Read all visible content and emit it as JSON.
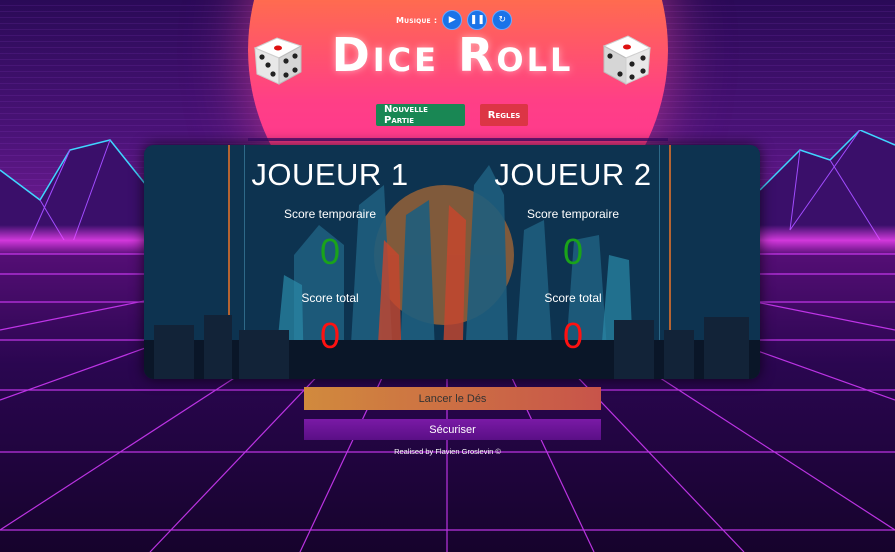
{
  "header": {
    "music_label": "Musique :",
    "music_buttons": [
      {
        "icon": "play-icon"
      },
      {
        "icon": "pause-icon"
      },
      {
        "icon": "replay-icon"
      }
    ],
    "title": "Dice Roll",
    "new_game_label": "Nouvelle Partie",
    "rules_label": "Regles"
  },
  "players": [
    {
      "name": "JOUEUR 1",
      "temp_label": "Score temporaire",
      "temp_score": "0",
      "total_label": "Score total",
      "total_score": "0"
    },
    {
      "name": "JOUEUR 2",
      "temp_label": "Score temporaire",
      "temp_score": "0",
      "total_label": "Score total",
      "total_score": "0"
    }
  ],
  "actions": {
    "roll_label": "Lancer le Dés",
    "hold_label": "Sécuriser"
  },
  "footer": {
    "credit": "Realised by Flavien Groslevin ©"
  },
  "colors": {
    "temp_score": "#1aa31a",
    "total_score": "#ff1111",
    "new_game_button": "#198754",
    "rules_button": "#dc3545",
    "music_button": "#1a73e8"
  }
}
